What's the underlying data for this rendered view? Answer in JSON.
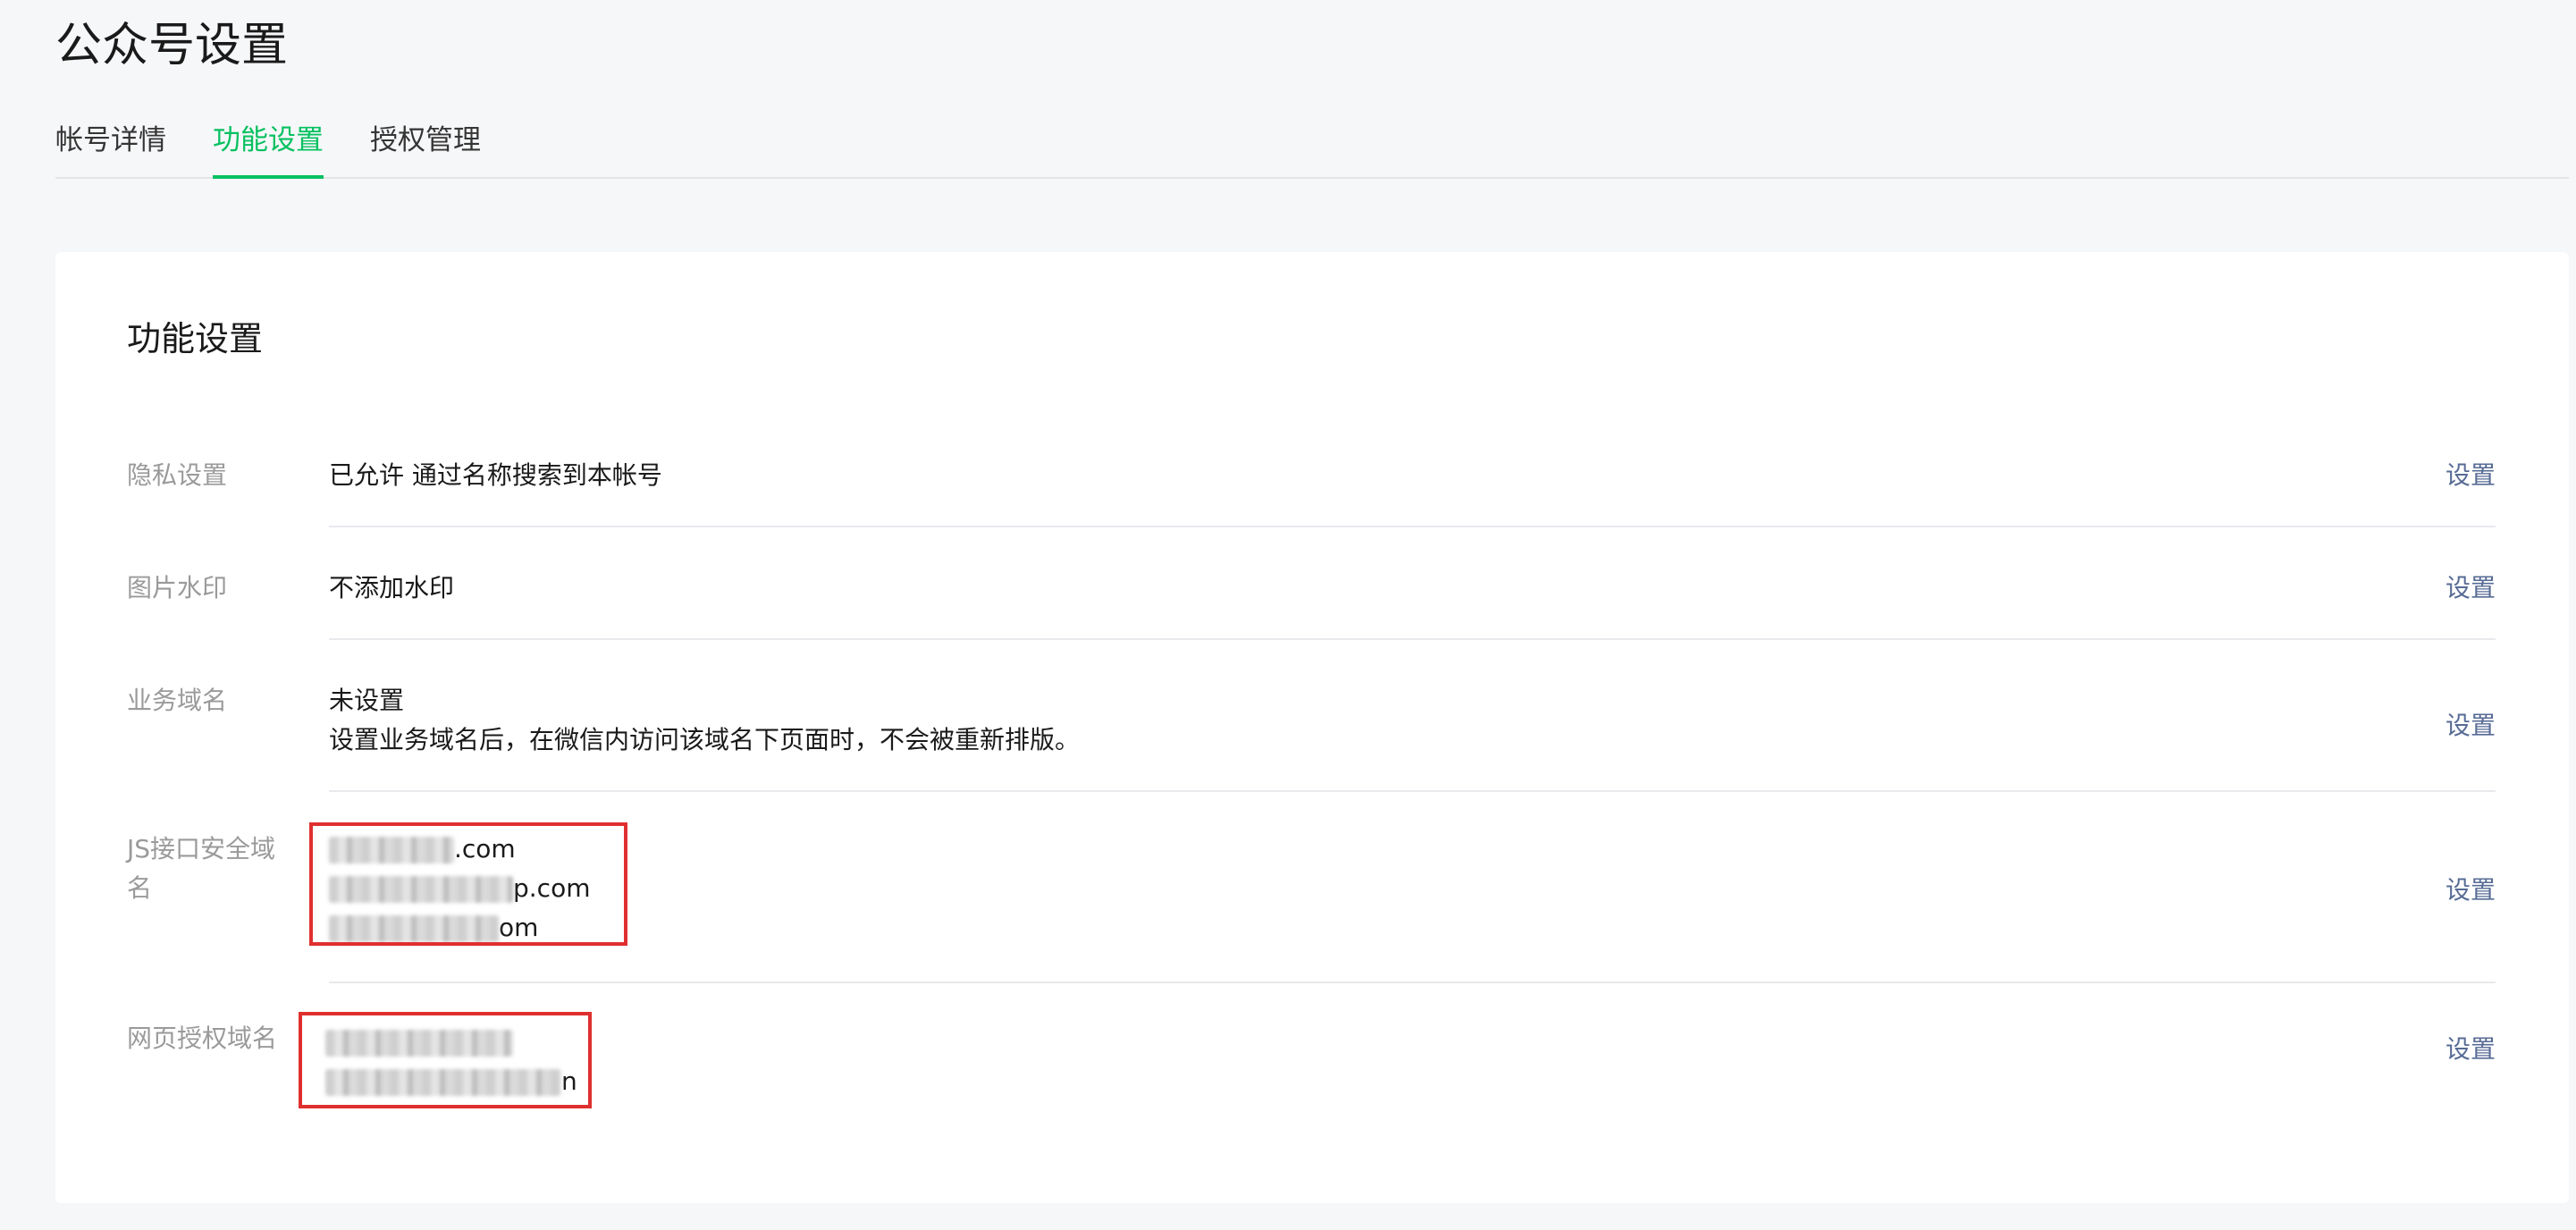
{
  "page": {
    "title": "公众号设置"
  },
  "tabs": [
    {
      "label": "帐号详情"
    },
    {
      "label": "功能设置"
    },
    {
      "label": "授权管理"
    }
  ],
  "card": {
    "title": "功能设置",
    "action_label": "设置",
    "rows": {
      "privacy": {
        "label": "隐私设置",
        "value": "已允许 通过名称搜索到本帐号"
      },
      "watermark": {
        "label": "图片水印",
        "value": "不添加水印"
      },
      "business_domain": {
        "label": "业务域名",
        "value": "未设置",
        "description": "设置业务域名后，在微信内访问该域名下页面时，不会被重新排版。"
      },
      "js_domain": {
        "label": "JS接口安全域名",
        "domains": [
          ".com",
          "p.com",
          "om"
        ]
      },
      "oauth_domain": {
        "label": "网页授权域名",
        "domains": [
          "",
          "n"
        ]
      }
    }
  },
  "colors": {
    "accent": "#07c160",
    "link": "#576b95",
    "highlight_box": "#e02f2f"
  }
}
